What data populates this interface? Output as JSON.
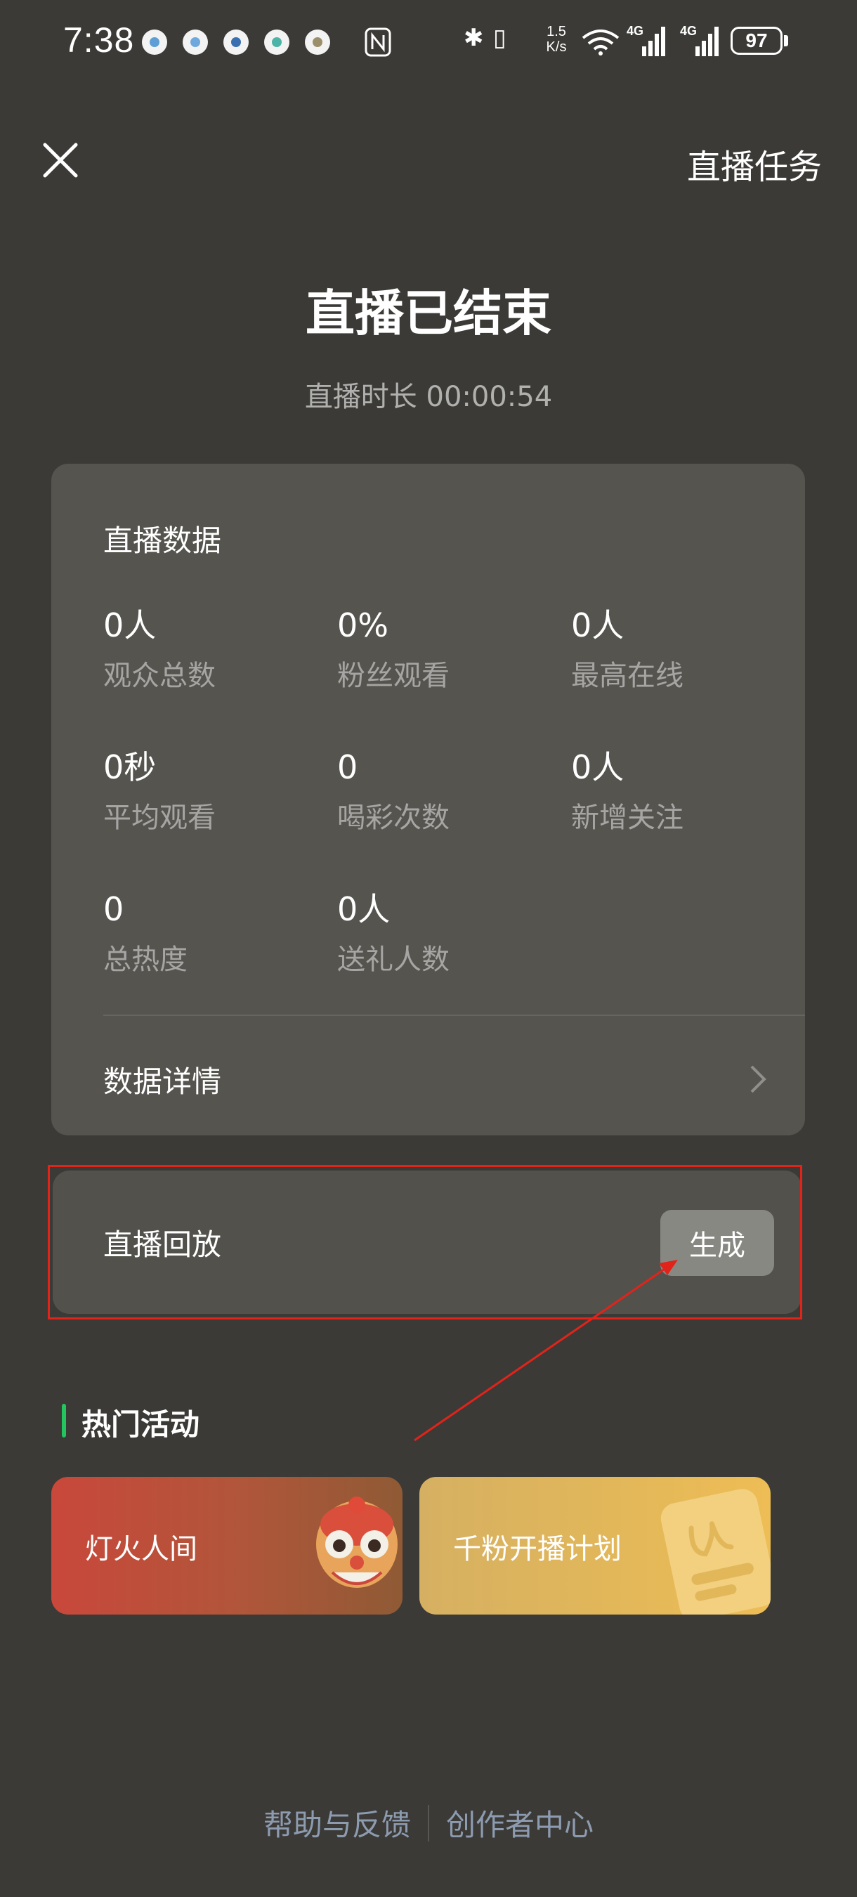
{
  "status_bar": {
    "time": "7:38",
    "network_speed": "1.5 K/s",
    "battery": "97",
    "signal_label_1": "4G",
    "signal_label_2": "4G"
  },
  "header": {
    "tasks_label": "直播任务"
  },
  "main": {
    "title": "直播已结束",
    "duration": "直播时长 00:00:54"
  },
  "stats_card": {
    "title": "直播数据",
    "stats": [
      {
        "value": "0人",
        "label": "观众总数"
      },
      {
        "value": "0%",
        "label": "粉丝观看"
      },
      {
        "value": "0人",
        "label": "最高在线"
      },
      {
        "value": "0秒",
        "label": "平均观看"
      },
      {
        "value": "0",
        "label": "喝彩次数"
      },
      {
        "value": "0人",
        "label": "新增关注"
      },
      {
        "value": "0",
        "label": "总热度"
      },
      {
        "value": "0人",
        "label": "送礼人数"
      }
    ],
    "details_label": "数据详情"
  },
  "replay": {
    "label": "直播回放",
    "button_label": "生成"
  },
  "activities": {
    "section_title": "热门活动",
    "items": [
      {
        "label": "灯火人间",
        "icon": "lion-dance-icon"
      },
      {
        "label": "千粉开播计划",
        "icon": "document-icon"
      }
    ]
  },
  "footer": {
    "help_label": "帮助与反馈",
    "creator_label": "创作者中心"
  },
  "colors": {
    "background": "#3b3a36",
    "card": "#55544f",
    "accent_green": "#22c55e",
    "highlight_red": "#e2231a"
  }
}
